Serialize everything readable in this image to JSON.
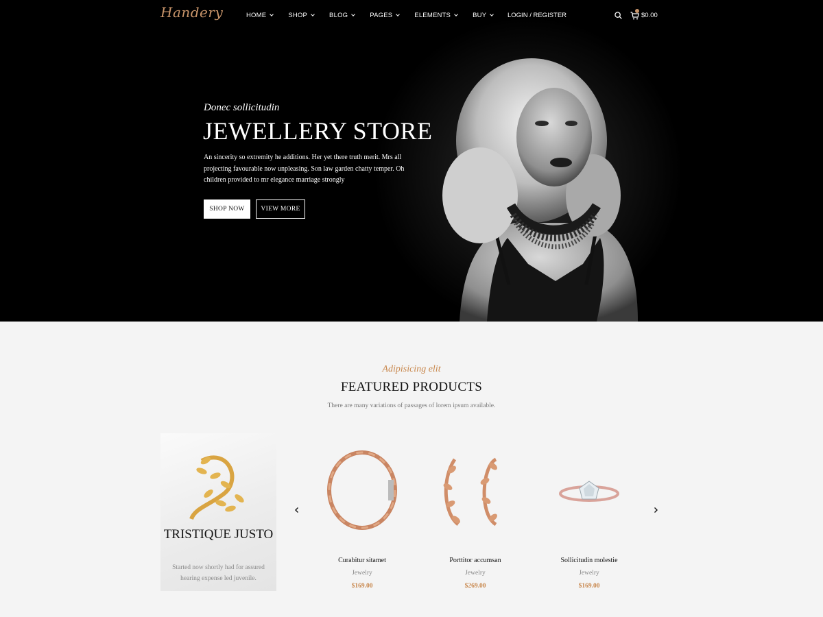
{
  "brand": {
    "logo_text": "Handery"
  },
  "nav": {
    "items": [
      {
        "label": "HOME"
      },
      {
        "label": "SHOP"
      },
      {
        "label": "BLOG"
      },
      {
        "label": "PAGES"
      },
      {
        "label": "ELEMENTS"
      },
      {
        "label": "BUY"
      }
    ],
    "login_label": "LOGIN / REGISTER",
    "cart_total": "$0.00",
    "search_icon": "search-icon",
    "cart_icon": "cart-icon"
  },
  "hero": {
    "subtitle": "Donec sollicitudin",
    "title": "JEWELLERY STORE",
    "description": "An sincerity so extremity he additions. Her yet there truth merit. Mrs all projecting favourable now unpleasing. Son law garden chatty temper. Oh children provided to mr elegance marriage strongly",
    "shop_button": "SHOP NOW",
    "view_button": "VIEW MORE"
  },
  "featured": {
    "kicker": "Adipisicing elit",
    "title": "FEATURED PRODUCTS",
    "description": "There are many variations of passages of lorem ipsum available."
  },
  "promo": {
    "title": "TRISTIQUE JUSTO",
    "description": "Started now shortly had for assured hearing expense led juvenile."
  },
  "products": [
    {
      "name": "Curabitur sitamet",
      "category": "Jewelry",
      "price": "$169.00",
      "icon": "bracelet-image"
    },
    {
      "name": "Porttitor accumsan",
      "category": "Jewelry",
      "price": "$269.00",
      "icon": "earrings-image"
    },
    {
      "name": "Sollicitudin molestie",
      "category": "Jewelry",
      "price": "$169.00",
      "icon": "ring-image"
    }
  ],
  "colors": {
    "accent": "#c8874c",
    "hero_bg": "#000000",
    "section_bg": "#f4f4f4"
  }
}
